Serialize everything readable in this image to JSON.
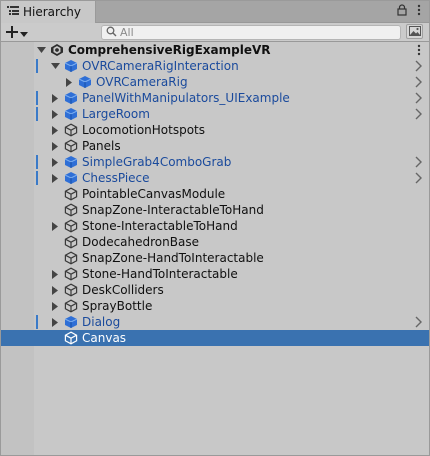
{
  "tab": {
    "title": "Hierarchy"
  },
  "toolbar": {
    "search_placeholder": "All"
  },
  "scene": {
    "name": "ComprehensiveRigExampleVR"
  },
  "rows": [
    {
      "label": "OVRCameraRigInteraction",
      "prefab": true,
      "expanded": true,
      "depth": 1,
      "marked": true
    },
    {
      "label": "OVRCameraRig",
      "prefab": true,
      "expanded": false,
      "depth": 2,
      "marked": false
    },
    {
      "label": "PanelWithManipulators_UIExample",
      "prefab": true,
      "expanded": false,
      "depth": 1,
      "marked": true
    },
    {
      "label": "LargeRoom",
      "prefab": true,
      "expanded": false,
      "depth": 1,
      "marked": true
    },
    {
      "label": "LocomotionHotspots",
      "prefab": false,
      "expanded": false,
      "depth": 1,
      "marked": false
    },
    {
      "label": "Panels",
      "prefab": false,
      "expanded": false,
      "depth": 1,
      "marked": false
    },
    {
      "label": "SimpleGrab4ComboGrab",
      "prefab": true,
      "expanded": false,
      "depth": 1,
      "marked": true
    },
    {
      "label": "ChessPiece",
      "prefab": true,
      "expanded": false,
      "depth": 1,
      "marked": true
    },
    {
      "label": "PointableCanvasModule",
      "prefab": false,
      "expanded": null,
      "depth": 1,
      "marked": false
    },
    {
      "label": "SnapZone-InteractableToHand",
      "prefab": false,
      "expanded": null,
      "depth": 1,
      "marked": false
    },
    {
      "label": "Stone-InteractableToHand",
      "prefab": false,
      "expanded": false,
      "depth": 1,
      "marked": false
    },
    {
      "label": "DodecahedronBase",
      "prefab": false,
      "expanded": null,
      "depth": 1,
      "marked": false
    },
    {
      "label": "SnapZone-HandToInteractable",
      "prefab": false,
      "expanded": null,
      "depth": 1,
      "marked": false
    },
    {
      "label": "Stone-HandToInteractable",
      "prefab": false,
      "expanded": false,
      "depth": 1,
      "marked": false
    },
    {
      "label": "DeskColliders",
      "prefab": false,
      "expanded": false,
      "depth": 1,
      "marked": false
    },
    {
      "label": "SprayBottle",
      "prefab": false,
      "expanded": false,
      "depth": 1,
      "marked": false
    },
    {
      "label": "Dialog",
      "prefab": true,
      "expanded": false,
      "depth": 1,
      "marked": true
    },
    {
      "label": "Canvas",
      "prefab": false,
      "expanded": null,
      "depth": 1,
      "marked": false,
      "selected": true
    }
  ],
  "colors": {
    "prefab_text": "#1a4a9c",
    "prefab_icon": "#2f6fd6",
    "selection": "#3a72b0",
    "mark": "#3a7ac8"
  },
  "icons": {
    "tab": "hierarchy-list-icon",
    "lock": "lock-icon",
    "menu": "kebab-menu-icon",
    "create": "plus-icon",
    "search": "search-icon",
    "scene": "unity-scene-icon",
    "gameobject": "cube-outline-icon",
    "prefab": "cube-filled-icon"
  }
}
